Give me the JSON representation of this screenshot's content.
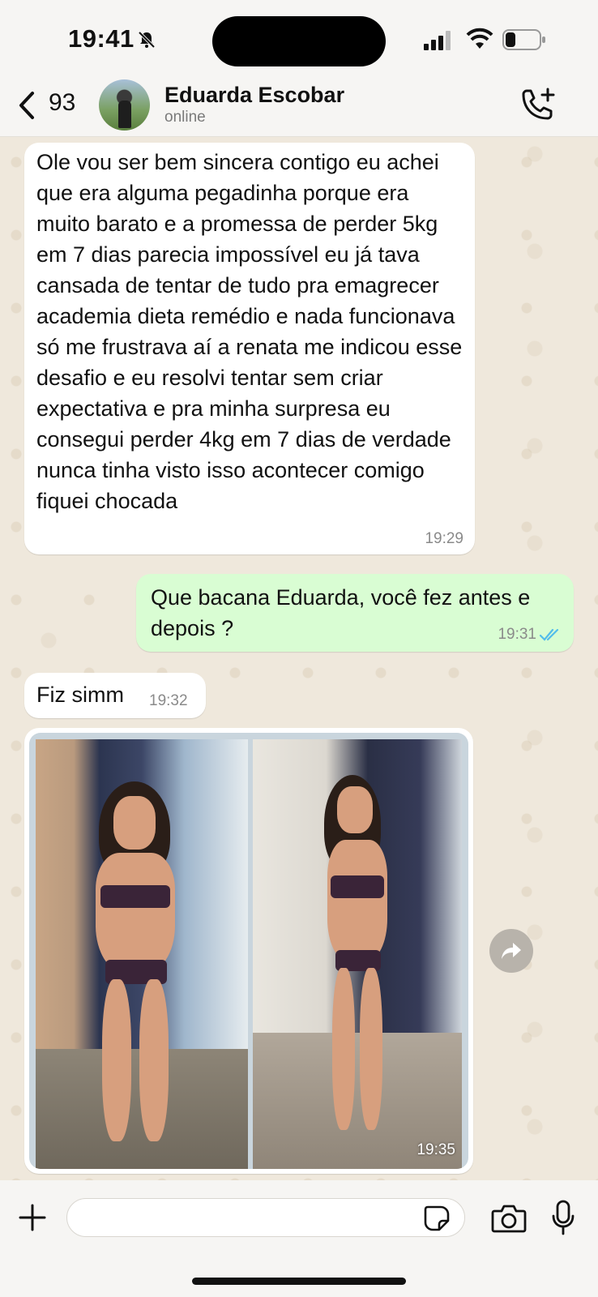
{
  "status_bar": {
    "time": "19:41"
  },
  "header": {
    "back_count": "93",
    "contact_name": "Eduarda Escobar",
    "contact_status": "online"
  },
  "messages": [
    {
      "direction": "incoming",
      "text": "Ole vou ser bem sincera contigo eu achei que era alguma pegadinha porque era muito barato e a promessa de perder 5kg em 7 dias parecia impossível eu já tava cansada de tentar de tudo pra emagrecer academia dieta remédio e nada funcionava só me frustrava aí a renata me indicou esse desafio e eu resolvi tentar sem criar expectativa e pra minha surpresa eu consegui perder 4kg em 7 dias de verdade nunca tinha visto isso acontecer comigo fiquei chocada",
      "time": "19:29"
    },
    {
      "direction": "outgoing",
      "text": "Que bacana Eduarda, você fez antes e depois ?",
      "time": "19:31"
    },
    {
      "direction": "incoming",
      "text": "Fiz simm",
      "time": "19:32"
    },
    {
      "direction": "incoming",
      "type": "image",
      "time": "19:35"
    }
  ],
  "input": {
    "placeholder": ""
  },
  "colors": {
    "outgoing_bubble": "#d9fdd3",
    "incoming_bubble": "#ffffff",
    "read_ticks": "#53bdeb"
  }
}
